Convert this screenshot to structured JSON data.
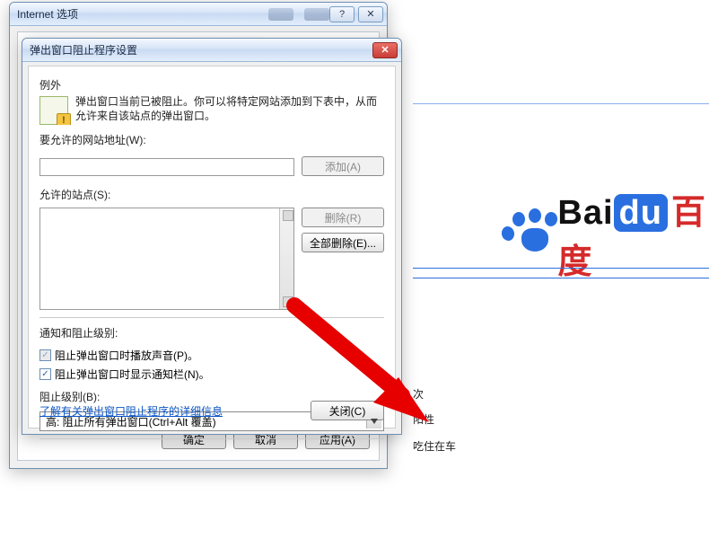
{
  "parent_window": {
    "title": "Internet 选项",
    "btn_ok": "确定",
    "btn_cancel": "取消",
    "btn_apply": "应用(A)"
  },
  "popup_dialog": {
    "title": "弹出窗口阻止程序设置",
    "exceptions_header": "例外",
    "intro_text": "弹出窗口当前已被阻止。你可以将特定网站添加到下表中，从而允许来自该站点的弹出窗口。",
    "address_label": "要允许的网站地址(W):",
    "address_value": "",
    "btn_add": "添加(A)",
    "allowed_label": "允许的站点(S):",
    "btn_remove": "删除(R)",
    "btn_remove_all": "全部删除(E)...",
    "notify_header": "通知和阻止级别:",
    "chk_sound_label": "阻止弹出窗口时播放声音(P)。",
    "chk_sound_checked": true,
    "chk_sound_disabled": true,
    "chk_infobar_label": "阻止弹出窗口时显示通知栏(N)。",
    "chk_infobar_checked": true,
    "block_level_label": "阻止级别(B):",
    "block_level_value": "高: 阻止所有弹出窗口(Ctrl+Alt 覆盖)",
    "learn_more": "了解有关弹出窗口阻止程序的详细信息",
    "btn_close": "关闭(C)"
  },
  "backdrop": {
    "logo_bai": "Bai",
    "logo_du": "du",
    "logo_cn": "百度",
    "snippet1": "次",
    "snippet2": "阳性",
    "snippet3": "吃住在车"
  }
}
